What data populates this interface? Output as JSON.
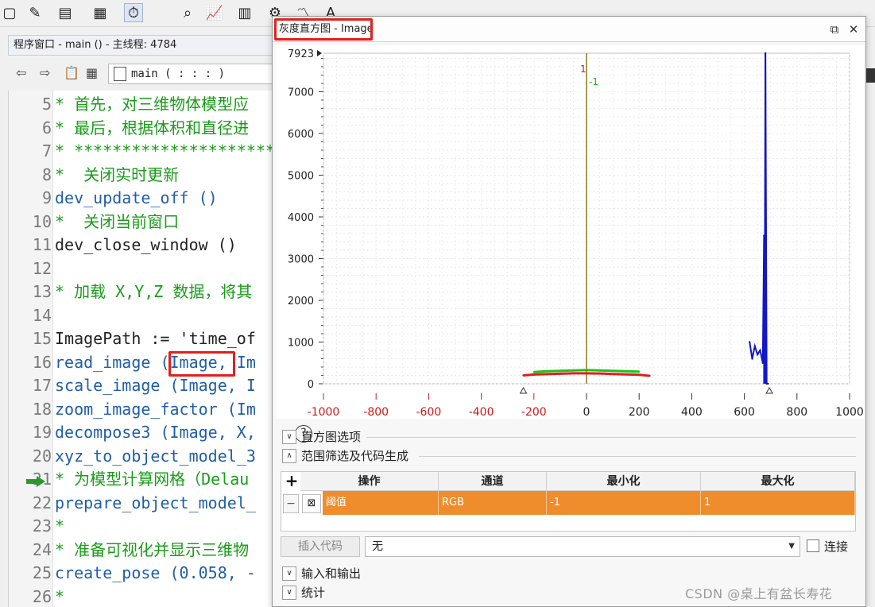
{
  "editor": {
    "title": "程序窗口 - main () - 主线程: 4784",
    "procedure": "main ( : : : )",
    "lines": [
      {
        "num": "5",
        "text": "* 首先，对三维物体模型应",
        "kind": "comment"
      },
      {
        "num": "6",
        "text": "* 最后，根据体积和直径进",
        "kind": "comment"
      },
      {
        "num": "7",
        "text": "* **********************",
        "kind": "comment"
      },
      {
        "num": "8",
        "text": "*  关闭实时更新",
        "kind": "comment"
      },
      {
        "num": "9",
        "text": "dev_update_off ()",
        "kind": "op"
      },
      {
        "num": "10",
        "text": "*  关闭当前窗口",
        "kind": "comment"
      },
      {
        "num": "11",
        "text": "dev_close_window ()",
        "kind": "plain"
      },
      {
        "num": "12",
        "text": "",
        "kind": "plain"
      },
      {
        "num": "13",
        "text": "* 加载 X,Y,Z 数据，将其",
        "kind": "comment"
      },
      {
        "num": "14",
        "text": "",
        "kind": "plain"
      },
      {
        "num": "15",
        "text": "ImagePath := 'time_of",
        "kind": "plain"
      },
      {
        "num": "16",
        "text": "read_image (Image, Im",
        "kind": "op"
      },
      {
        "num": "17",
        "text": "scale_image (Image, I",
        "kind": "op"
      },
      {
        "num": "18",
        "text": "zoom_image_factor (Im",
        "kind": "op"
      },
      {
        "num": "19",
        "text": "decompose3 (Image, X,",
        "kind": "op"
      },
      {
        "num": "20",
        "text": "xyz_to_object_model_3",
        "kind": "op"
      },
      {
        "num": "21",
        "text": "* 为模型计算网格（Delau",
        "kind": "comment"
      },
      {
        "num": "22",
        "text": "prepare_object_model_",
        "kind": "op"
      },
      {
        "num": "23",
        "text": "*",
        "kind": "comment"
      },
      {
        "num": "24",
        "text": "* 准备可视化并显示三维物",
        "kind": "comment"
      },
      {
        "num": "25",
        "text": "create_pose (0.058, -",
        "kind": "op"
      },
      {
        "num": "26",
        "text": "*",
        "kind": "comment"
      }
    ]
  },
  "dialog": {
    "title": "灰度直方图 - Image",
    "sections": {
      "histogram_options": "直方图选项",
      "range_filter": "范围筛选及代码生成",
      "io": "输入和输出",
      "stats": "统计"
    },
    "table": {
      "headers": [
        "操作",
        "通道",
        "最小化",
        "最大化"
      ],
      "row": {
        "op": "阈值",
        "channel": "RGB",
        "min": "-1",
        "max": "1"
      }
    },
    "insert_code_label": "插入代码",
    "combo_value": "无",
    "connect_label": "连接"
  },
  "chart_data": {
    "type": "line",
    "title": "",
    "xlim": [
      -1000,
      1000
    ],
    "ylim": [
      0,
      7923
    ],
    "x_ticks": [
      -1000,
      -800,
      -600,
      -400,
      -200,
      0,
      200,
      400,
      600,
      800,
      1000
    ],
    "y_ticks": [
      0,
      1000,
      2000,
      3000,
      4000,
      5000,
      6000,
      7000
    ],
    "y_max_label": "7923",
    "markers": [
      {
        "label": "1",
        "x": 0,
        "color": "#d01818"
      },
      {
        "label": "-1",
        "x": 0,
        "color": "#22bb22"
      }
    ],
    "series": [
      {
        "color": "#dd1f1f",
        "x": [
          -240,
          -200,
          -150,
          -100,
          -50,
          0,
          50,
          100,
          150,
          200,
          240
        ],
        "y": [
          200,
          220,
          230,
          240,
          250,
          250,
          245,
          235,
          225,
          215,
          190
        ]
      },
      {
        "color": "#22c01a",
        "x": [
          -200,
          -150,
          -100,
          -50,
          0,
          50,
          100,
          150,
          200
        ],
        "y": [
          280,
          300,
          310,
          320,
          330,
          320,
          310,
          300,
          290
        ]
      },
      {
        "color": "#1216c8",
        "x": [
          620,
          630,
          640,
          650,
          660,
          670,
          675,
          678,
          680,
          685,
          690
        ],
        "y": [
          1000,
          600,
          900,
          700,
          800,
          500,
          3550,
          3000,
          7923,
          0,
          0
        ]
      }
    ]
  },
  "watermark": "CSDN @桌上有盆长寿花"
}
